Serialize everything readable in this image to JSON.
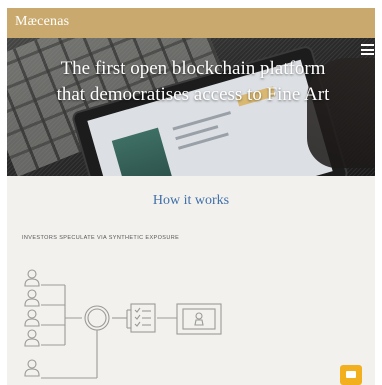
{
  "header": {
    "logo_text": "Mæcenas",
    "menu_icon": "hamburger-menu-icon"
  },
  "hero": {
    "title_line1": "The first open blockchain platform",
    "title_line2": "that democratises access to Fine Art"
  },
  "how_it_works": {
    "title": "How it works",
    "subtitle": "INVESTORS SPECULATE VIA SYNTHETIC EXPOSURE",
    "diagram_icons": [
      "person-icon",
      "person-icon",
      "person-icon",
      "person-icon",
      "person-icon",
      "token-coin-icon",
      "contract-document-icon",
      "framed-artwork-icon"
    ]
  },
  "chat": {
    "icon": "chat-bubble-icon"
  },
  "colors": {
    "brand_gold": "#c9a96e",
    "heading_blue": "#3f6fa8",
    "chat_orange": "#f2b01e",
    "diagram_stroke": "#9a9a96"
  }
}
